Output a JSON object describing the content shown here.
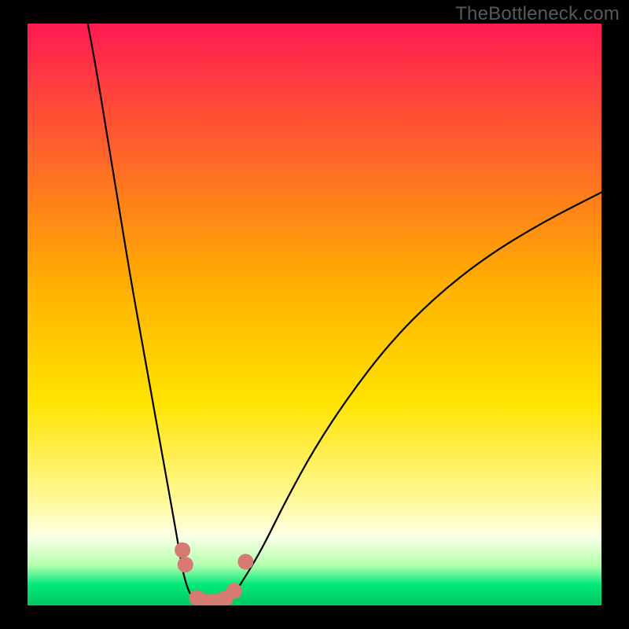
{
  "watermark": "TheBottleneck.com",
  "chart_data": {
    "type": "line",
    "title": "",
    "xlabel": "",
    "ylabel": "",
    "xlim": [
      0,
      100
    ],
    "ylim": [
      0,
      100
    ],
    "grid": false,
    "legend": false,
    "background_gradient": {
      "stops": [
        {
          "offset": 0.0,
          "color": "#ff1a52"
        },
        {
          "offset": 0.45,
          "color": "#ffb000"
        },
        {
          "offset": 0.65,
          "color": "#ffe300"
        },
        {
          "offset": 0.82,
          "color": "#fff99a"
        },
        {
          "offset": 0.88,
          "color": "#fdffe6"
        },
        {
          "offset": 0.93,
          "color": "#b6ffb0"
        },
        {
          "offset": 0.965,
          "color": "#00e878"
        },
        {
          "offset": 1.0,
          "color": "#00c864"
        }
      ]
    },
    "series": [
      {
        "name": "left-curve",
        "color": "#000000",
        "x": [
          10.5,
          12,
          14,
          16,
          18,
          20,
          22,
          24,
          26,
          27,
          28,
          29,
          30
        ],
        "y": [
          100,
          92,
          80,
          68,
          56,
          45,
          34,
          23,
          12,
          6,
          2.5,
          1,
          0.4
        ]
      },
      {
        "name": "right-curve",
        "color": "#000000",
        "x": [
          34,
          36,
          38,
          41,
          45,
          50,
          56,
          63,
          71,
          80,
          90,
          100
        ],
        "y": [
          0.4,
          2,
          5,
          10,
          18,
          27,
          36,
          45,
          53,
          60,
          66,
          71
        ]
      },
      {
        "name": "valley-floor",
        "color": "#000000",
        "x": [
          30,
          31,
          32,
          33,
          34
        ],
        "y": [
          0.4,
          0.2,
          0.2,
          0.2,
          0.4
        ]
      }
    ],
    "markers": [
      {
        "x": 27.0,
        "y": 9.5,
        "r": 1.4,
        "color": "#d77a72"
      },
      {
        "x": 27.5,
        "y": 7.0,
        "r": 1.4,
        "color": "#d77a72"
      },
      {
        "x": 29.5,
        "y": 1.3,
        "r": 1.4,
        "color": "#d77a72"
      },
      {
        "x": 30.5,
        "y": 0.8,
        "r": 1.4,
        "color": "#d77a72"
      },
      {
        "x": 32.0,
        "y": 0.7,
        "r": 1.4,
        "color": "#d77a72"
      },
      {
        "x": 33.5,
        "y": 0.8,
        "r": 1.4,
        "color": "#d77a72"
      },
      {
        "x": 34.5,
        "y": 1.2,
        "r": 1.4,
        "color": "#d77a72"
      },
      {
        "x": 36.0,
        "y": 2.5,
        "r": 1.4,
        "color": "#d77a72"
      },
      {
        "x": 38.0,
        "y": 7.5,
        "r": 1.4,
        "color": "#d77a72"
      }
    ]
  }
}
